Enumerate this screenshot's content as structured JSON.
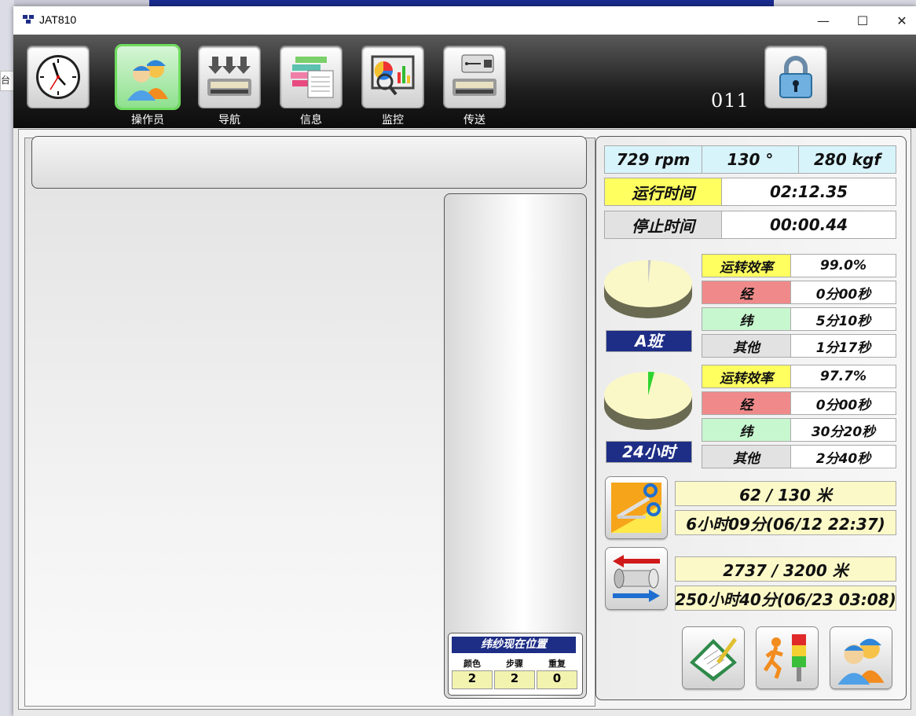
{
  "window": {
    "title": "JAT810",
    "minimize": "—",
    "maximize": "☐",
    "close": "✕"
  },
  "background": {
    "fragment_text": "台联"
  },
  "toolbar": {
    "buttons": [
      {
        "label": "",
        "icon": "clock-icon"
      },
      {
        "label": "操作员",
        "icon": "operators-icon",
        "selected": true
      },
      {
        "label": "导航",
        "icon": "navigation-icon"
      },
      {
        "label": "信息",
        "icon": "information-icon"
      },
      {
        "label": "监控",
        "icon": "monitor-icon"
      },
      {
        "label": "传送",
        "icon": "usb-transfer-icon"
      }
    ],
    "counter": "011",
    "lock_icon": "padlock-icon"
  },
  "status": {
    "speed": "729 rpm",
    "angle": "130 °",
    "tension": "280 kgf",
    "run_time_label": "运行时间",
    "run_time": "02:12.35",
    "stop_time_label": "停止时间",
    "stop_time": "00:00.44"
  },
  "shift_a": {
    "tag": "A班",
    "efficiency_label": "运转效率",
    "efficiency": "99.0%",
    "efficiency_value": 99.0,
    "warp_label": "经",
    "warp": "0分00秒",
    "weft_label": "纬",
    "weft": "5分10秒",
    "other_label": "其他",
    "other": "1分17秒"
  },
  "shift_24h": {
    "tag": "24小时",
    "efficiency_label": "运转效率",
    "efficiency": "97.7%",
    "efficiency_value": 97.7,
    "warp_label": "经",
    "warp": "0分00秒",
    "weft_label": "纬",
    "weft": "30分20秒",
    "other_label": "其他",
    "other": "2分40秒"
  },
  "cloth": {
    "length": "62 / 130 米",
    "eta": "6小时09分(06/12 22:37)"
  },
  "beam": {
    "length": "2737 / 3200 米",
    "eta": "250小时40分(06/23 03:08)"
  },
  "weft_position": {
    "title": "纬纱现在位置",
    "color_label": "颜色",
    "step_label": "步骤",
    "repeat_label": "重复",
    "color": "2",
    "step": "2",
    "repeat": "0"
  },
  "colors": {
    "accent_navy": "#1e2e86",
    "selected_green": "#6fdc5e"
  }
}
